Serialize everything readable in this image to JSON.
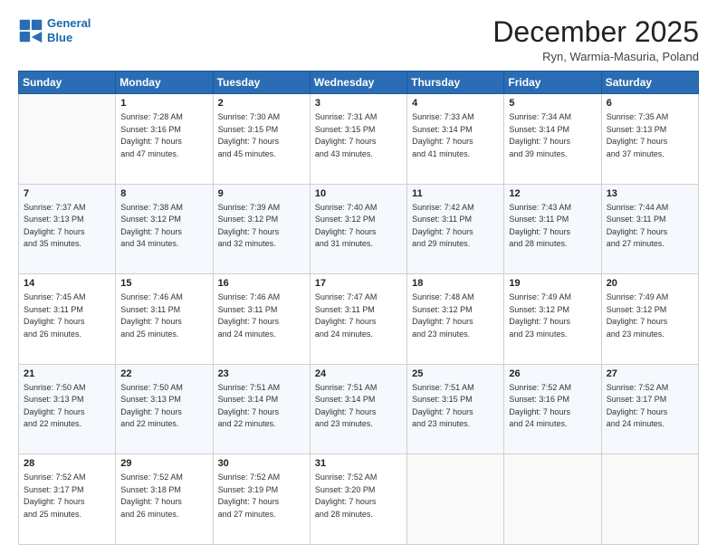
{
  "logo": {
    "line1": "General",
    "line2": "Blue"
  },
  "title": "December 2025",
  "location": "Ryn, Warmia-Masuria, Poland",
  "days_header": [
    "Sunday",
    "Monday",
    "Tuesday",
    "Wednesday",
    "Thursday",
    "Friday",
    "Saturday"
  ],
  "weeks": [
    [
      {
        "num": "",
        "info": ""
      },
      {
        "num": "1",
        "info": "Sunrise: 7:28 AM\nSunset: 3:16 PM\nDaylight: 7 hours\nand 47 minutes."
      },
      {
        "num": "2",
        "info": "Sunrise: 7:30 AM\nSunset: 3:15 PM\nDaylight: 7 hours\nand 45 minutes."
      },
      {
        "num": "3",
        "info": "Sunrise: 7:31 AM\nSunset: 3:15 PM\nDaylight: 7 hours\nand 43 minutes."
      },
      {
        "num": "4",
        "info": "Sunrise: 7:33 AM\nSunset: 3:14 PM\nDaylight: 7 hours\nand 41 minutes."
      },
      {
        "num": "5",
        "info": "Sunrise: 7:34 AM\nSunset: 3:14 PM\nDaylight: 7 hours\nand 39 minutes."
      },
      {
        "num": "6",
        "info": "Sunrise: 7:35 AM\nSunset: 3:13 PM\nDaylight: 7 hours\nand 37 minutes."
      }
    ],
    [
      {
        "num": "7",
        "info": "Sunrise: 7:37 AM\nSunset: 3:13 PM\nDaylight: 7 hours\nand 35 minutes."
      },
      {
        "num": "8",
        "info": "Sunrise: 7:38 AM\nSunset: 3:12 PM\nDaylight: 7 hours\nand 34 minutes."
      },
      {
        "num": "9",
        "info": "Sunrise: 7:39 AM\nSunset: 3:12 PM\nDaylight: 7 hours\nand 32 minutes."
      },
      {
        "num": "10",
        "info": "Sunrise: 7:40 AM\nSunset: 3:12 PM\nDaylight: 7 hours\nand 31 minutes."
      },
      {
        "num": "11",
        "info": "Sunrise: 7:42 AM\nSunset: 3:11 PM\nDaylight: 7 hours\nand 29 minutes."
      },
      {
        "num": "12",
        "info": "Sunrise: 7:43 AM\nSunset: 3:11 PM\nDaylight: 7 hours\nand 28 minutes."
      },
      {
        "num": "13",
        "info": "Sunrise: 7:44 AM\nSunset: 3:11 PM\nDaylight: 7 hours\nand 27 minutes."
      }
    ],
    [
      {
        "num": "14",
        "info": "Sunrise: 7:45 AM\nSunset: 3:11 PM\nDaylight: 7 hours\nand 26 minutes."
      },
      {
        "num": "15",
        "info": "Sunrise: 7:46 AM\nSunset: 3:11 PM\nDaylight: 7 hours\nand 25 minutes."
      },
      {
        "num": "16",
        "info": "Sunrise: 7:46 AM\nSunset: 3:11 PM\nDaylight: 7 hours\nand 24 minutes."
      },
      {
        "num": "17",
        "info": "Sunrise: 7:47 AM\nSunset: 3:11 PM\nDaylight: 7 hours\nand 24 minutes."
      },
      {
        "num": "18",
        "info": "Sunrise: 7:48 AM\nSunset: 3:12 PM\nDaylight: 7 hours\nand 23 minutes."
      },
      {
        "num": "19",
        "info": "Sunrise: 7:49 AM\nSunset: 3:12 PM\nDaylight: 7 hours\nand 23 minutes."
      },
      {
        "num": "20",
        "info": "Sunrise: 7:49 AM\nSunset: 3:12 PM\nDaylight: 7 hours\nand 23 minutes."
      }
    ],
    [
      {
        "num": "21",
        "info": "Sunrise: 7:50 AM\nSunset: 3:13 PM\nDaylight: 7 hours\nand 22 minutes."
      },
      {
        "num": "22",
        "info": "Sunrise: 7:50 AM\nSunset: 3:13 PM\nDaylight: 7 hours\nand 22 minutes."
      },
      {
        "num": "23",
        "info": "Sunrise: 7:51 AM\nSunset: 3:14 PM\nDaylight: 7 hours\nand 22 minutes."
      },
      {
        "num": "24",
        "info": "Sunrise: 7:51 AM\nSunset: 3:14 PM\nDaylight: 7 hours\nand 23 minutes."
      },
      {
        "num": "25",
        "info": "Sunrise: 7:51 AM\nSunset: 3:15 PM\nDaylight: 7 hours\nand 23 minutes."
      },
      {
        "num": "26",
        "info": "Sunrise: 7:52 AM\nSunset: 3:16 PM\nDaylight: 7 hours\nand 24 minutes."
      },
      {
        "num": "27",
        "info": "Sunrise: 7:52 AM\nSunset: 3:17 PM\nDaylight: 7 hours\nand 24 minutes."
      }
    ],
    [
      {
        "num": "28",
        "info": "Sunrise: 7:52 AM\nSunset: 3:17 PM\nDaylight: 7 hours\nand 25 minutes."
      },
      {
        "num": "29",
        "info": "Sunrise: 7:52 AM\nSunset: 3:18 PM\nDaylight: 7 hours\nand 26 minutes."
      },
      {
        "num": "30",
        "info": "Sunrise: 7:52 AM\nSunset: 3:19 PM\nDaylight: 7 hours\nand 27 minutes."
      },
      {
        "num": "31",
        "info": "Sunrise: 7:52 AM\nSunset: 3:20 PM\nDaylight: 7 hours\nand 28 minutes."
      },
      {
        "num": "",
        "info": ""
      },
      {
        "num": "",
        "info": ""
      },
      {
        "num": "",
        "info": ""
      }
    ]
  ]
}
